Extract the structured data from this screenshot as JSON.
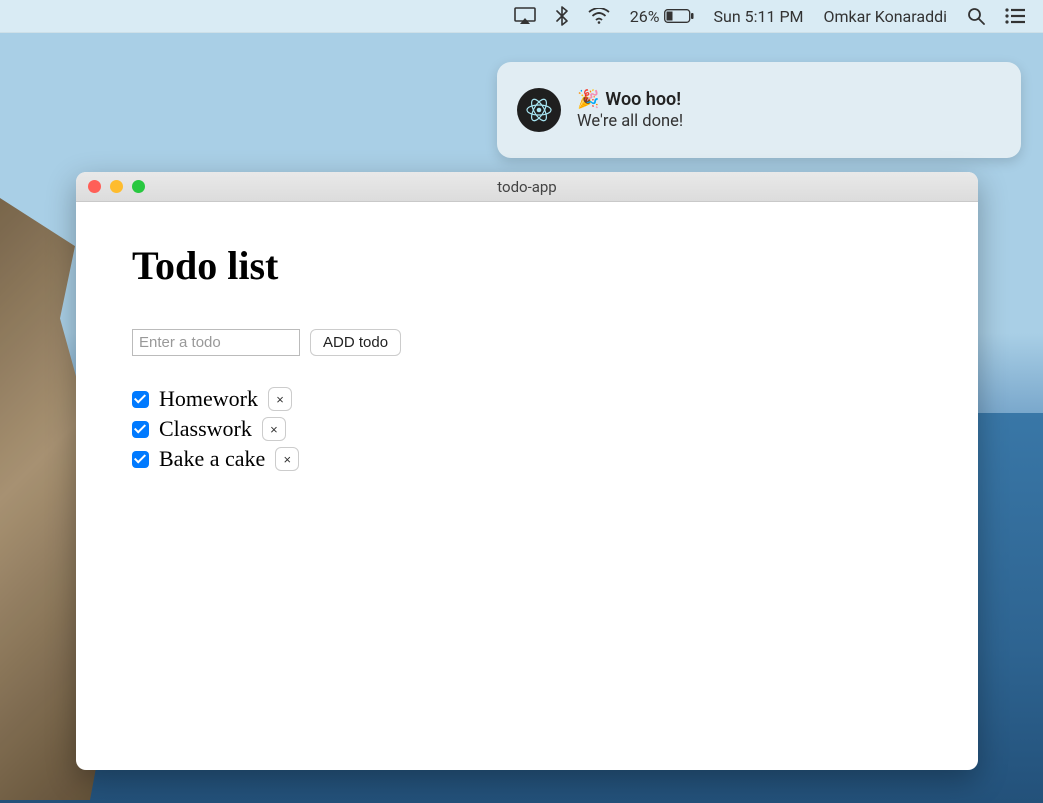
{
  "menubar": {
    "battery_percent": "26%",
    "clock": "Sun 5:11 PM",
    "user_name": "Omkar Konaraddi"
  },
  "notification": {
    "emoji": "🎉",
    "title": "Woo hoo!",
    "body": "We're all done!"
  },
  "window": {
    "title": "todo-app"
  },
  "app": {
    "heading": "Todo list",
    "input_placeholder": "Enter a todo",
    "input_value": "",
    "add_button_label": "ADD todo",
    "remove_symbol": "×",
    "todos": [
      {
        "label": "Homework",
        "checked": true
      },
      {
        "label": "Classwork",
        "checked": true
      },
      {
        "label": "Bake a cake",
        "checked": true
      }
    ]
  }
}
